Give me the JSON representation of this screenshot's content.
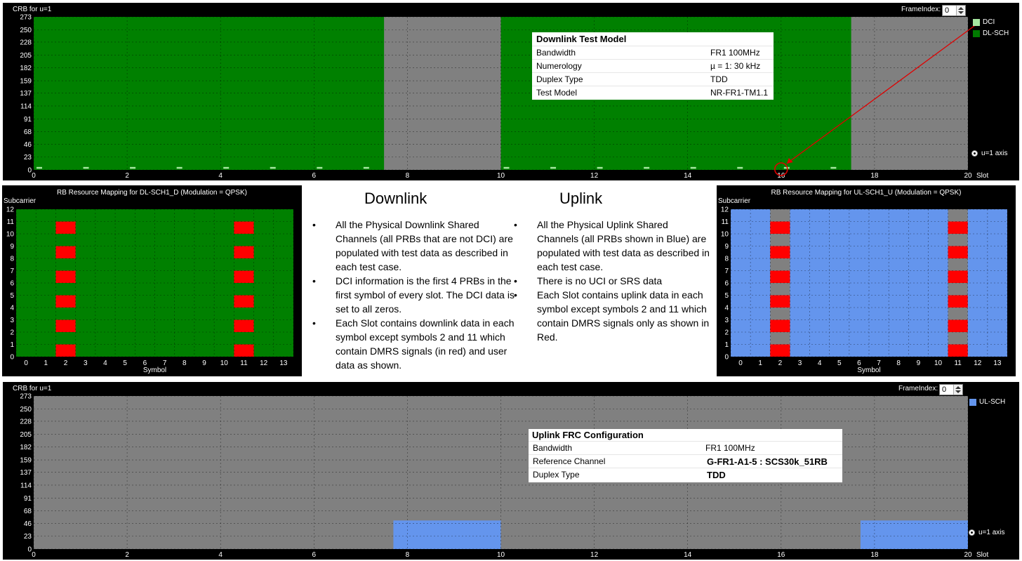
{
  "top_chart": {
    "ylabel": "CRB for u=1",
    "frame_label": "FrameIndex:",
    "frame_value": "0",
    "yticks": [
      "273",
      "250",
      "228",
      "205",
      "182",
      "159",
      "137",
      "114",
      "91",
      "68",
      "46",
      "23",
      "0"
    ],
    "xticks": [
      "0",
      "2",
      "4",
      "6",
      "8",
      "10",
      "12",
      "14",
      "16",
      "18",
      "20"
    ],
    "xunit": "Slot",
    "legend": [
      {
        "label": "DCI",
        "color": "#a6e6a0"
      },
      {
        "label": "DL-SCH",
        "color": "#007a00"
      }
    ],
    "radio_label": "u=1 axis",
    "colors": {
      "dl": "#008000",
      "gap": "#808080",
      "dci": "#a6e6a0",
      "callout": "#e00000"
    },
    "infobox": {
      "title": "Downlink Test Model",
      "rows": [
        {
          "k": "Bandwidth",
          "v": "FR1 100MHz"
        },
        {
          "k": "Numerology",
          "v": "µ = 1: 30 kHz"
        },
        {
          "k": "Duplex Type",
          "v": "TDD"
        },
        {
          "k": "Test Model",
          "v": "NR-FR1-TM1.1"
        }
      ]
    }
  },
  "dl_map": {
    "title": "RB Resource Mapping for DL-SCH1_D (Modulation = QPSK)",
    "ylabel": "Subcarrier",
    "xlabel": "Symbol",
    "yticks": [
      "12",
      "11",
      "10",
      "9",
      "8",
      "7",
      "6",
      "5",
      "4",
      "3",
      "2",
      "1",
      "0"
    ],
    "xticks": [
      "0",
      "1",
      "2",
      "3",
      "4",
      "5",
      "6",
      "7",
      "8",
      "9",
      "10",
      "11",
      "12",
      "13"
    ],
    "colors": {
      "base": "#008000",
      "dmrs": "#ff0000"
    }
  },
  "ul_map": {
    "title": "RB Resource Mapping for UL-SCH1_U (Modulation = QPSK)",
    "ylabel": "Subcarrier",
    "xlabel": "Symbol",
    "yticks": [
      "12",
      "11",
      "10",
      "9",
      "8",
      "7",
      "6",
      "5",
      "4",
      "3",
      "2",
      "1",
      "0"
    ],
    "xticks": [
      "0",
      "1",
      "2",
      "3",
      "4",
      "5",
      "6",
      "7",
      "8",
      "9",
      "10",
      "11",
      "12",
      "13"
    ],
    "colors": {
      "base": "#6495ed",
      "dmrs": "#ff0000",
      "empty": "#808080"
    }
  },
  "downlink_text": {
    "heading": "Downlink",
    "bullets": [
      "All the Physical Downlink Shared Channels (all PRBs that are not DCI) are populated with test data as described in each test case.",
      "DCI information is the first 4 PRBs in the first symbol of every slot.  The DCI data is set to all zeros.",
      "Each Slot contains downlink data in each symbol except symbols 2 and 11 which contain DMRS signals (in red) and user data as shown."
    ]
  },
  "uplink_text": {
    "heading": "Uplink",
    "bullets": [
      "All the Physical Uplink Shared Channels (all PRBs shown in Blue) are populated with test data as described in each test case.",
      "There is no UCI or SRS data",
      "Each Slot contains uplink data in each symbol except symbols 2 and 11 which contain DMRS signals only as shown in Red."
    ]
  },
  "bottom_chart": {
    "ylabel": "CRB for u=1",
    "frame_label": "FrameIndex:",
    "frame_value": "0",
    "yticks": [
      "273",
      "250",
      "228",
      "205",
      "182",
      "159",
      "137",
      "114",
      "91",
      "68",
      "46",
      "23",
      "0"
    ],
    "xticks": [
      "0",
      "2",
      "4",
      "6",
      "8",
      "10",
      "12",
      "14",
      "16",
      "18",
      "20"
    ],
    "xunit": "Slot",
    "legend": [
      {
        "label": "UL-SCH",
        "color": "#6495ed"
      }
    ],
    "radio_label": "u=1 axis",
    "colors": {
      "gap": "#808080",
      "ul": "#6495ed"
    },
    "infobox": {
      "title": "Uplink FRC Configuration",
      "rows": [
        {
          "k": "Bandwidth",
          "v": "FR1 100MHz"
        },
        {
          "k": "Reference Channel",
          "v": "G-FR1-A1-5 : SCS30k_51RB"
        },
        {
          "k": "Duplex Type",
          "v": "TDD"
        }
      ]
    }
  },
  "chart_data": [
    {
      "type": "heatmap",
      "title": "",
      "xlabel": "Slot",
      "ylabel": "CRB for u=1",
      "xlim": [
        0,
        20
      ],
      "ylim": [
        0,
        273
      ],
      "series": [
        {
          "name": "DL-SCH",
          "slot_ranges": [
            [
              0,
              7.5
            ],
            [
              10,
              17.5
            ]
          ],
          "crb_range": [
            0,
            273
          ]
        },
        {
          "name": "DCI",
          "slot_starts": [
            0,
            1,
            2,
            3,
            4,
            5,
            6,
            7,
            10,
            11,
            12,
            13,
            14,
            15,
            16,
            17
          ],
          "crb_range": [
            0,
            4
          ]
        }
      ]
    },
    {
      "type": "heatmap",
      "title": "RB Resource Mapping for DL-SCH1_D (Modulation = QPSK)",
      "xlabel": "Symbol",
      "ylabel": "Subcarrier",
      "xlim": [
        0,
        14
      ],
      "ylim": [
        0,
        12
      ],
      "dmrs_symbols": [
        2,
        11
      ],
      "dmrs_subcarriers": [
        0,
        2,
        4,
        6,
        8,
        10
      ]
    },
    {
      "type": "heatmap",
      "title": "RB Resource Mapping for UL-SCH1_U (Modulation = QPSK)",
      "xlabel": "Symbol",
      "ylabel": "Subcarrier",
      "xlim": [
        0,
        14
      ],
      "ylim": [
        0,
        12
      ],
      "dmrs_symbols": [
        2,
        11
      ],
      "dmrs_subcarriers": [
        0,
        2,
        4,
        6,
        8,
        10
      ]
    },
    {
      "type": "heatmap",
      "title": "",
      "xlabel": "Slot",
      "ylabel": "CRB for u=1",
      "xlim": [
        0,
        20
      ],
      "ylim": [
        0,
        273
      ],
      "series": [
        {
          "name": "UL-SCH",
          "slot_ranges": [
            [
              7.7,
              10
            ],
            [
              17.7,
              20
            ]
          ],
          "crb_range": [
            0,
            51
          ]
        }
      ]
    }
  ]
}
